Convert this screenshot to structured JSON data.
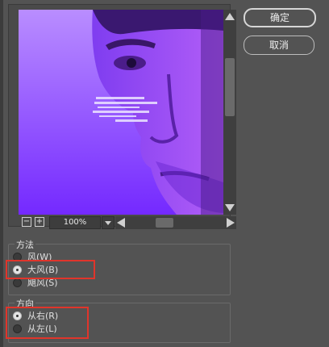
{
  "buttons": {
    "ok": "确定",
    "cancel": "取消"
  },
  "zoom": {
    "value": "100%",
    "minus": "−",
    "plus": "+"
  },
  "method": {
    "title": "方法",
    "options": [
      "风(W)",
      "大风(B)",
      "飓风(S)"
    ],
    "selected": 1
  },
  "direction": {
    "title": "方向",
    "options": [
      "从右(R)",
      "从左(L)"
    ],
    "selected": 0
  },
  "colors": {
    "background": "#535353",
    "highlight": "#e0352b",
    "preview_top": "#b68cff",
    "preview_bottom": "#7a2bff"
  },
  "icons": [
    "zoom-out-icon",
    "zoom-in-icon",
    "dropdown-arrow-icon",
    "scroll-up-icon",
    "scroll-down-icon",
    "scroll-left-icon",
    "scroll-right-icon"
  ]
}
